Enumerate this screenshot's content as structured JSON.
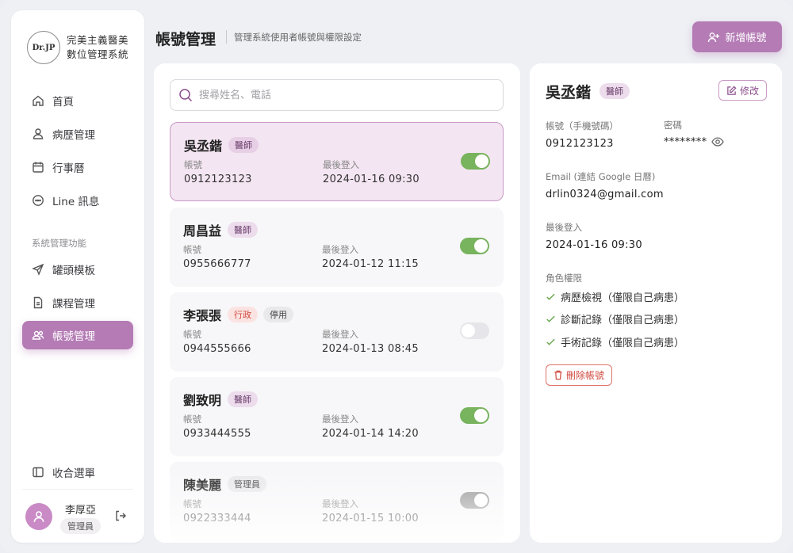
{
  "brand": {
    "logo_text": "Dr.JP",
    "name_line1": "完美主義醫美",
    "name_line2": "數位管理系統"
  },
  "sidebar": {
    "items": [
      {
        "label": "首頁",
        "icon": "home-icon"
      },
      {
        "label": "病歷管理",
        "icon": "user-icon"
      },
      {
        "label": "行事曆",
        "icon": "calendar-icon"
      },
      {
        "label": "Line 訊息",
        "icon": "chat-icon"
      }
    ],
    "section_label": "系統管理功能",
    "admin_items": [
      {
        "label": "罐頭模板",
        "icon": "send-icon"
      },
      {
        "label": "課程管理",
        "icon": "document-icon"
      },
      {
        "label": "帳號管理",
        "icon": "users-icon",
        "active": true
      }
    ],
    "collapse_label": "收合選單"
  },
  "user": {
    "name": "李厚亞",
    "role": "管理員"
  },
  "header": {
    "title": "帳號管理",
    "subtitle": "管理系統使用者帳號與權限設定",
    "add_button": "新增帳號"
  },
  "search": {
    "placeholder": "搜尋姓名、電話",
    "value": ""
  },
  "labels": {
    "account": "帳號",
    "last_login": "最後登入"
  },
  "accounts": [
    {
      "name": "吳丞鍇",
      "badges": [
        "醫師"
      ],
      "account": "0912123123",
      "last_login": "2024-01-16 09:30",
      "enabled": true,
      "selected": true
    },
    {
      "name": "周昌益",
      "badges": [
        "醫師"
      ],
      "account": "0955666777",
      "last_login": "2024-01-12 11:15",
      "enabled": true
    },
    {
      "name": "李張張",
      "badges": [
        "行政",
        "停用"
      ],
      "account": "0944555666",
      "last_login": "2024-01-13 08:45",
      "enabled": false
    },
    {
      "name": "劉致明",
      "badges": [
        "醫師"
      ],
      "account": "0933444555",
      "last_login": "2024-01-14 14:20",
      "enabled": true
    },
    {
      "name": "陳美麗",
      "badges": [
        "管理員"
      ],
      "account": "0922333444",
      "last_login": "2024-01-15 10:00",
      "enabled": true
    }
  ],
  "detail": {
    "name": "吳丞鍇",
    "badge": "醫師",
    "edit_button": "修改",
    "account_label": "帳號（手機號碼）",
    "account_value": "0912123123",
    "password_label": "密碼",
    "password_value": "********",
    "email_label": "Email (連結 Google 日曆)",
    "email_value": "drlin0324@gmail.com",
    "last_login_label": "最後登入",
    "last_login_value": "2024-01-16 09:30",
    "roles_label": "角色權限",
    "permissions": [
      "病歷檢視（僅限自己病患）",
      "診斷記錄（僅限自己病患）",
      "手術記錄（僅限自己病患）"
    ],
    "delete_button": "刪除帳號"
  },
  "colors": {
    "accent": "#b47bb5",
    "toggle_on": "#78b35e",
    "danger": "#d04a3f"
  }
}
